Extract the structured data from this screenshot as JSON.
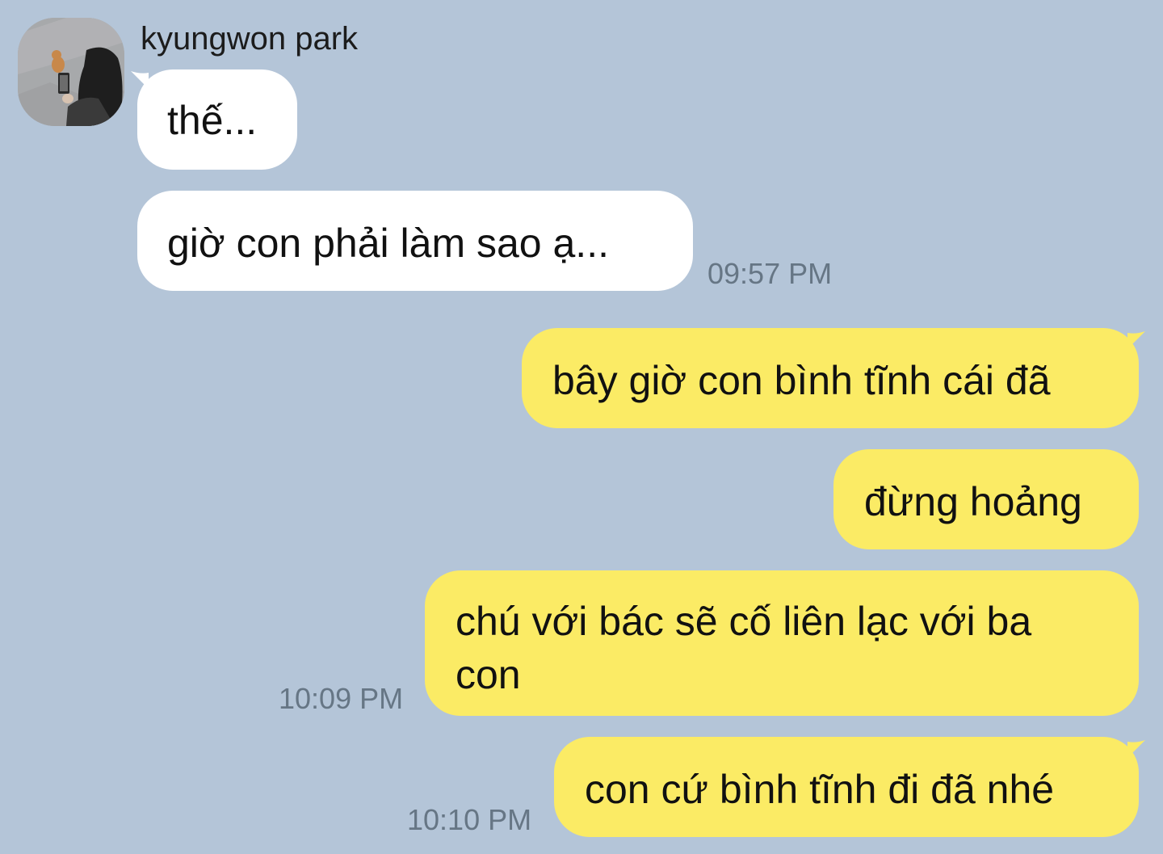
{
  "chat": {
    "sender": {
      "name": "kyungwon park"
    },
    "messages": [
      {
        "direction": "in",
        "text": "thế..."
      },
      {
        "direction": "in",
        "text": "giờ con phải làm sao ạ...",
        "time": "09:57 PM"
      },
      {
        "direction": "out",
        "text": "bây giờ con bình tĩnh cái đã"
      },
      {
        "direction": "out",
        "text": "đừng hoảng"
      },
      {
        "direction": "out",
        "text_line1": "chú với bác sẽ cố liên lạc với ba",
        "text_line2": "con",
        "time": "10:09 PM"
      },
      {
        "direction": "out",
        "text": "con cứ bình tĩnh đi đã nhé",
        "time": "10:10 PM"
      }
    ]
  },
  "colors": {
    "background": "#b4c5d8",
    "incoming_bubble": "#ffffff",
    "outgoing_bubble": "#fbeb65",
    "timestamp": "#667685"
  }
}
